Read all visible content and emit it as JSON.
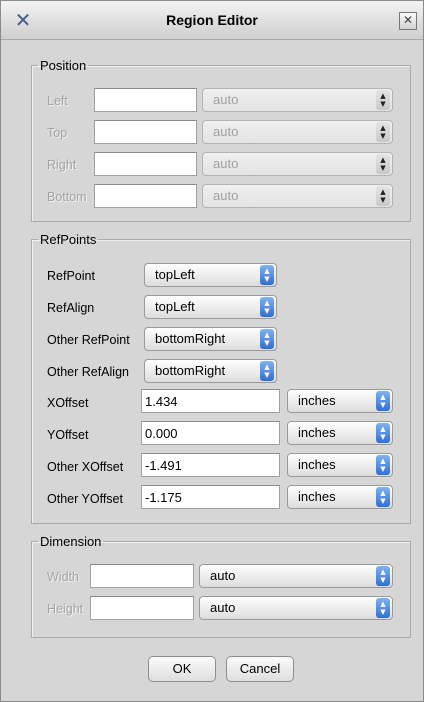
{
  "window": {
    "title": "Region Editor"
  },
  "position": {
    "legend": "Position",
    "rows": [
      {
        "label": "Left",
        "value": "",
        "unit": "auto"
      },
      {
        "label": "Top",
        "value": "",
        "unit": "auto"
      },
      {
        "label": "Right",
        "value": "",
        "unit": "auto"
      },
      {
        "label": "Bottom",
        "value": "",
        "unit": "auto"
      }
    ]
  },
  "refpoints": {
    "legend": "RefPoints",
    "ref_point": {
      "label": "RefPoint",
      "value": "topLeft"
    },
    "ref_align": {
      "label": "RefAlign",
      "value": "topLeft"
    },
    "other_ref_point": {
      "label": "Other RefPoint",
      "value": "bottomRight"
    },
    "other_ref_align": {
      "label": "Other RefAlign",
      "value": "bottomRight"
    },
    "x_offset": {
      "label": "XOffset",
      "value": "1.434",
      "unit": "inches"
    },
    "y_offset": {
      "label": "YOffset",
      "value": "0.000",
      "unit": "inches"
    },
    "other_x_offset": {
      "label": "Other XOffset",
      "value": "-1.491",
      "unit": "inches"
    },
    "other_y_offset": {
      "label": "Other YOffset",
      "value": "-1.175",
      "unit": "inches"
    }
  },
  "dimension": {
    "legend": "Dimension",
    "width": {
      "label": "Width",
      "value": "",
      "unit": "auto"
    },
    "height": {
      "label": "Height",
      "value": "",
      "unit": "auto"
    }
  },
  "buttons": {
    "ok": "OK",
    "cancel": "Cancel"
  }
}
